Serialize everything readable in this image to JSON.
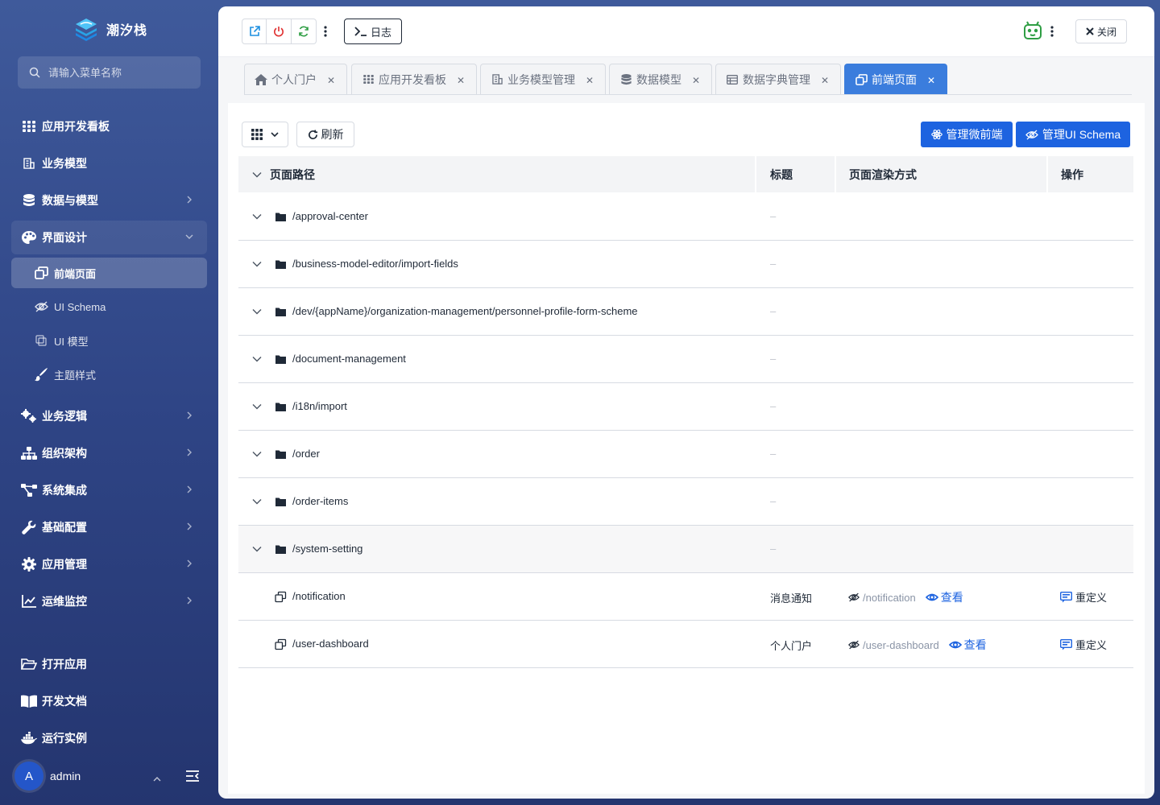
{
  "app": {
    "name": "潮汐栈",
    "search_placeholder": "请输入菜单名称"
  },
  "sidebar": {
    "items": [
      {
        "label": "应用开发看板",
        "icon": "grid-icon"
      },
      {
        "label": "业务模型",
        "icon": "building-icon"
      },
      {
        "label": "数据与模型",
        "icon": "database-icon"
      },
      {
        "label": "界面设计",
        "icon": "palette-icon"
      },
      {
        "label": "业务逻辑",
        "icon": "cogs-icon"
      },
      {
        "label": "组织架构",
        "icon": "org-chart-icon"
      },
      {
        "label": "系统集成",
        "icon": "share-nodes-icon"
      },
      {
        "label": "基础配置",
        "icon": "wrench-icon"
      },
      {
        "label": "应用管理",
        "icon": "gear-icon"
      },
      {
        "label": "运维监控",
        "icon": "line-chart-icon"
      },
      {
        "label": "打开应用",
        "icon": "folder-open-icon"
      },
      {
        "label": "开发文档",
        "icon": "book-icon"
      },
      {
        "label": "运行实例",
        "icon": "docker-icon"
      }
    ],
    "subitems": [
      {
        "label": "前端页面",
        "icon": "window-restore-icon"
      },
      {
        "label": "UI Schema",
        "icon": "eye-slash-icon"
      },
      {
        "label": "UI 模型",
        "icon": "clone-icon"
      },
      {
        "label": "主题样式",
        "icon": "brush-icon"
      }
    ],
    "user": {
      "avatar_letter": "A",
      "name": "admin"
    }
  },
  "toolbar": {
    "log_label": "日志",
    "close_label": "关闭"
  },
  "tabs": [
    {
      "label": "个人门户",
      "icon": "home-icon"
    },
    {
      "label": "应用开发看板",
      "icon": "grid-icon"
    },
    {
      "label": "业务模型管理",
      "icon": "building-icon"
    },
    {
      "label": "数据模型",
      "icon": "database-icon"
    },
    {
      "label": "数据字典管理",
      "icon": "table-icon"
    },
    {
      "label": "前端页面",
      "icon": "window-restore-icon"
    }
  ],
  "actions": {
    "refresh_label": "刷新",
    "manage_micro_label": "管理微前端",
    "manage_schema_label": "管理UI Schema"
  },
  "table": {
    "columns": [
      "页面路径",
      "标题",
      "页面渲染方式",
      "操作"
    ],
    "rows": [
      {
        "path": "/approval-center",
        "type": "folder",
        "title": "–"
      },
      {
        "path": "/business-model-editor/import-fields",
        "type": "folder",
        "title": "–"
      },
      {
        "path": "/dev/{appName}/organization-management/personnel-profile-form-scheme",
        "type": "folder",
        "title": "–"
      },
      {
        "path": "/document-management",
        "type": "folder",
        "title": "–"
      },
      {
        "path": "/i18n/import",
        "type": "folder",
        "title": "–"
      },
      {
        "path": "/order",
        "type": "folder",
        "title": "–"
      },
      {
        "path": "/order-items",
        "type": "folder",
        "title": "–"
      },
      {
        "path": "/system-setting",
        "type": "folder",
        "title": "–"
      },
      {
        "path": "/notification",
        "type": "page",
        "title": "消息通知",
        "render": "/notification",
        "view": "查看",
        "action": "重定义"
      },
      {
        "path": "/user-dashboard",
        "type": "page",
        "title": "个人门户",
        "render": "/user-dashboard",
        "view": "查看",
        "action": "重定义"
      }
    ]
  },
  "colors": {
    "primary": "#1d63e0",
    "active_tab": "#3b7ddd",
    "sidebar_top": "#3f5a9b",
    "sidebar_bottom": "#24356f"
  }
}
